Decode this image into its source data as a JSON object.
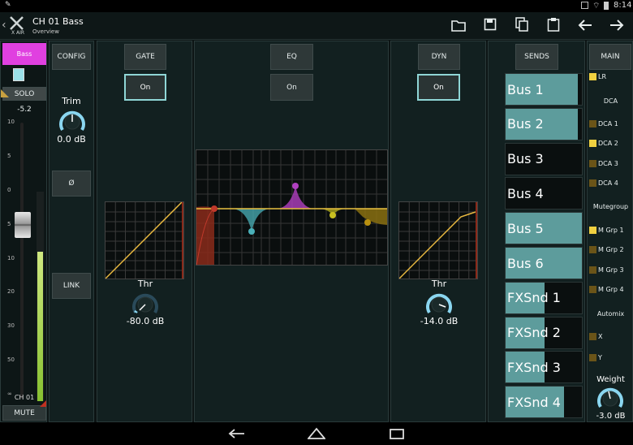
{
  "status": {
    "time": "8:14"
  },
  "header": {
    "channel_title": "CH 01 Bass",
    "subtitle": "Overview",
    "logo_text": "X AIR",
    "icons": [
      "back-chevron-icon",
      "folder-icon",
      "save-icon",
      "copy-icon",
      "paste-icon",
      "undo-arrow-icon",
      "redo-arrow-icon"
    ]
  },
  "fader_strip": {
    "name_button": "Bass",
    "name_color": "#e040e0",
    "solo_label": "SOLO",
    "fader_value": "-5.2",
    "fader_level": 0.63,
    "meter_level": 0.72,
    "scale": [
      "10",
      "5",
      "0",
      "5",
      "10",
      "20",
      "30",
      "50",
      "∞"
    ],
    "channel_label": "CH 01",
    "mute_label": "MUTE"
  },
  "config": {
    "config_label": "CONFIG",
    "trim_label": "Trim",
    "trim_value": "0.0 dB",
    "phase_label": "Ø",
    "link_label": "LINK"
  },
  "gate": {
    "title": "GATE",
    "on_label": "On",
    "thr_label": "Thr",
    "thr_value": "-80.0 dB"
  },
  "eq": {
    "title": "EQ",
    "on_label": "On",
    "band_colors": [
      "#c0392b",
      "#4ab0b8",
      "#b040c0",
      "#c8c020",
      "#b89010"
    ]
  },
  "dyn": {
    "title": "DYN",
    "on_label": "On",
    "thr_label": "Thr",
    "thr_value": "-14.0 dB"
  },
  "sends": {
    "title": "SENDS",
    "items": [
      {
        "label": "Bus 1",
        "level": 0.93
      },
      {
        "label": "Bus 2",
        "level": 0.93
      },
      {
        "label": "Bus 3",
        "level": 0
      },
      {
        "label": "Bus 4",
        "level": 0
      },
      {
        "label": "Bus 5",
        "level": 1.0
      },
      {
        "label": "Bus 6",
        "level": 1.0
      },
      {
        "label": "FXSnd 1",
        "level": 0.5
      },
      {
        "label": "FXSnd 2",
        "level": 0.5
      },
      {
        "label": "FXSnd 3",
        "level": 0.5
      },
      {
        "label": "FXSnd 4",
        "level": 0.75
      }
    ]
  },
  "main": {
    "title": "MAIN",
    "lr_label": "LR",
    "dca_heading": "DCA",
    "dca": [
      {
        "label": "DCA 1",
        "active": false
      },
      {
        "label": "DCA 2",
        "active": true
      },
      {
        "label": "DCA 3",
        "active": false
      },
      {
        "label": "DCA 4",
        "active": false
      }
    ],
    "mutegroup_heading": "Mutegroup",
    "mute_groups": [
      {
        "label": "M Grp 1",
        "active": true
      },
      {
        "label": "M Grp 2",
        "active": false
      },
      {
        "label": "M Grp 3",
        "active": false
      },
      {
        "label": "M Grp 4",
        "active": false
      }
    ],
    "automix_heading": "Automix",
    "automix": [
      {
        "label": "X",
        "active": false
      },
      {
        "label": "Y",
        "active": false
      }
    ],
    "weight_label": "Weight",
    "weight_value": "-3.0 dB"
  }
}
